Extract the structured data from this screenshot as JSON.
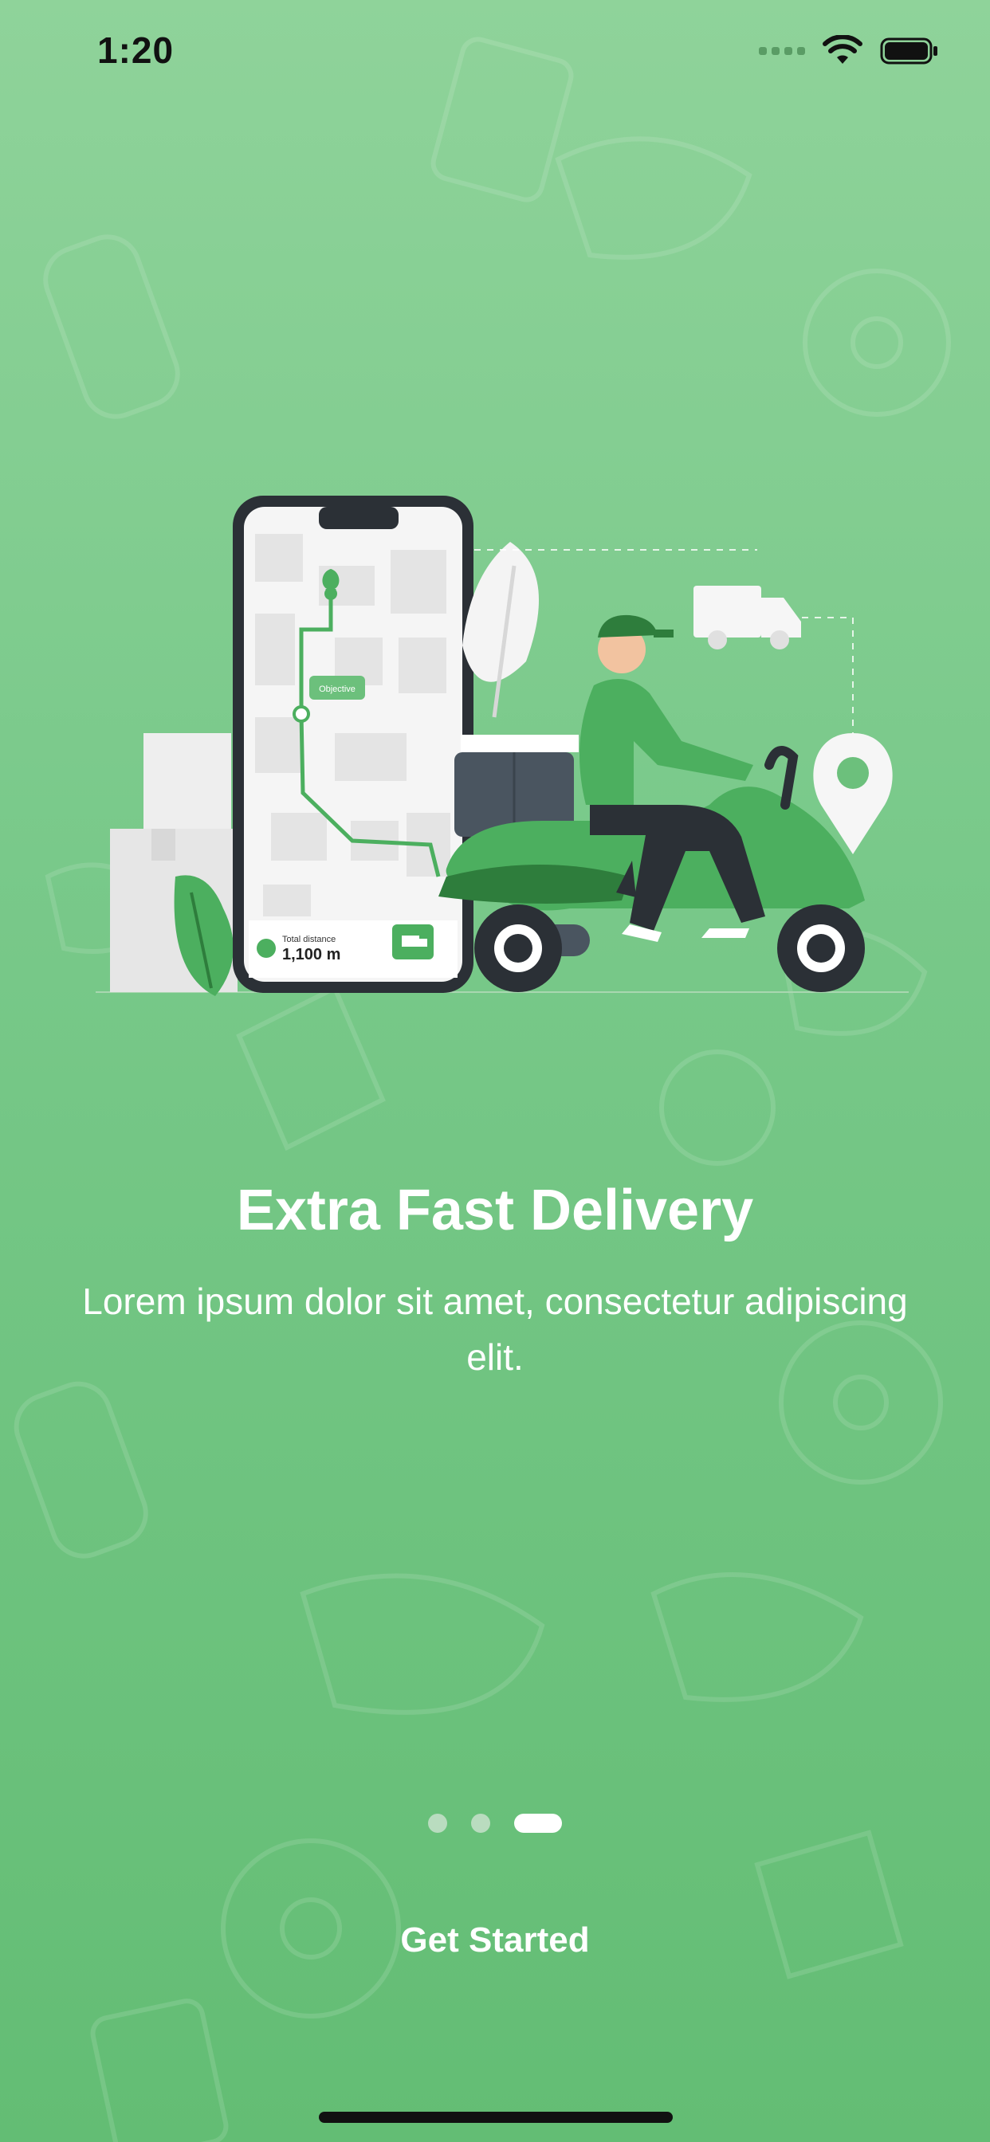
{
  "status_bar": {
    "time": "1:20"
  },
  "illustration": {
    "objective_label": "Objective",
    "distance_caption": "Total distance",
    "distance_value": "1,100 m"
  },
  "onboarding": {
    "title": "Extra Fast Delivery",
    "subtitle": "Lorem ipsum dolor sit amet, consectetur adipiscing elit.",
    "page_count": 3,
    "active_page": 3,
    "cta_label": "Get Started"
  },
  "colors": {
    "background_top": "#8fd39a",
    "background_bottom": "#63bd74",
    "accent_green": "#4caf5f",
    "dark": "#2b3036"
  }
}
